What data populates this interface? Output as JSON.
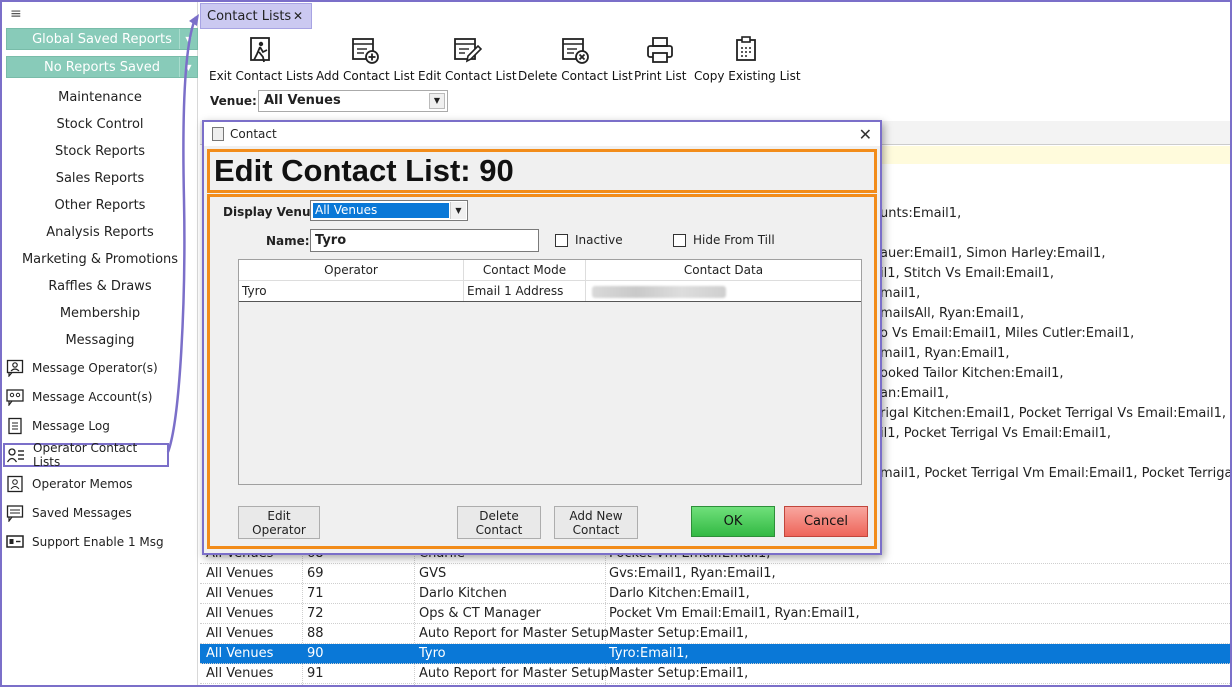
{
  "sidebar": {
    "global_saved_reports": "Global Saved Reports",
    "no_reports_saved": "No Reports Saved",
    "menu": [
      {
        "label": "Maintenance"
      },
      {
        "label": "Stock Control"
      },
      {
        "label": "Stock Reports"
      },
      {
        "label": "Sales Reports"
      },
      {
        "label": "Other Reports"
      },
      {
        "label": "Analysis Reports"
      },
      {
        "label": "Marketing & Promotions"
      },
      {
        "label": "Raffles & Draws"
      },
      {
        "label": "Membership"
      },
      {
        "label": "Messaging"
      }
    ],
    "icon_items": [
      {
        "label": "Message Operator(s)",
        "icon": "message-operator-icon"
      },
      {
        "label": "Message Account(s)",
        "icon": "message-account-icon"
      },
      {
        "label": "Message Log",
        "icon": "message-log-icon"
      },
      {
        "label": "Operator Contact Lists",
        "icon": "contact-list-icon",
        "selected": true
      },
      {
        "label": "Operator Memos",
        "icon": "memo-icon"
      },
      {
        "label": "Saved Messages",
        "icon": "saved-message-icon"
      },
      {
        "label": "Support Enable 1 Msg",
        "icon": "support-icon"
      }
    ]
  },
  "tab": {
    "label": "Contact Lists",
    "close": "✕"
  },
  "toolbar": {
    "exit": "Exit Contact Lists",
    "add": "Add Contact List",
    "edit": "Edit Contact List",
    "delete": "Delete Contact List",
    "print": "Print List",
    "copy": "Copy Existing List"
  },
  "venue": {
    "label": "Venue:",
    "value": "All Venues"
  },
  "background_text": [
    "unts:Email1,",
    "auer:Email1, Simon  Harley:Email1,",
    "il1, Stitch Vs Email:Email1,",
    "mail1,",
    "mailsAll, Ryan:Email1,",
    "o Vs Email:Email1, Miles  Cutler:Email1,",
    "mail1, Ryan:Email1,",
    "ooked Tailor Kitchen:Email1,",
    "an:Email1,",
    "rigal Kitchen:Email1, Pocket Terrigal Vs Email:Email1,",
    "il1, Pocket Terrigal Vs Email:Email1,",
    "mail1, Pocket Terrigal Vm Email:Email1, Pocket Terrigal"
  ],
  "grid_rows": [
    {
      "venue": "All Venues",
      "id": "68",
      "name": "Charlie",
      "data": "Pocket Vm Email:Email1,"
    },
    {
      "venue": "All Venues",
      "id": "69",
      "name": "GVS",
      "data": "Gvs:Email1, Ryan:Email1,"
    },
    {
      "venue": "All Venues",
      "id": "71",
      "name": "Darlo Kitchen",
      "data": "Darlo Kitchen:Email1,"
    },
    {
      "venue": "All Venues",
      "id": "72",
      "name": "Ops & CT Manager",
      "data": "Pocket Vm Email:Email1, Ryan:Email1,"
    },
    {
      "venue": "All Venues",
      "id": "88",
      "name": "Auto Report for Master Setup",
      "data": "Master Setup:Email1,"
    },
    {
      "venue": "All Venues",
      "id": "90",
      "name": "Tyro",
      "data": "Tyro:Email1,",
      "selected": true
    },
    {
      "venue": "All Venues",
      "id": "91",
      "name": "Auto Report for Master Setup",
      "data": "Master Setup:Email1,"
    }
  ],
  "dialog": {
    "title": "Contact",
    "heading": "Edit Contact List: 90",
    "display_venue_label": "Display Venue:",
    "display_venue_value": "All Venues",
    "name_label": "Name:",
    "name_value": "Tyro",
    "inactive_label": "Inactive",
    "hide_from_till_label": "Hide From Till",
    "columns": [
      "Operator",
      "Contact Mode",
      "Contact Data"
    ],
    "rows": [
      {
        "operator": "Tyro",
        "mode": "Email 1 Address",
        "data": ""
      }
    ],
    "buttons": {
      "edit_operator_line1": "Edit",
      "edit_operator_line2": "Operator",
      "delete_contact_line1": "Delete",
      "delete_contact_line2": "Contact",
      "add_new_contact_line1": "Add New",
      "add_new_contact_line2": "Contact",
      "ok": "OK",
      "cancel": "Cancel"
    }
  },
  "colors": {
    "accent_purple": "#7b6fc9",
    "highlight_orange": "#f28c1a",
    "sidebar_green": "#88cbb9",
    "selection_blue": "#0a78d7"
  }
}
